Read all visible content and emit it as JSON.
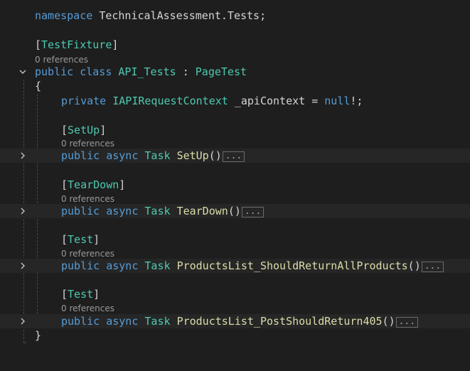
{
  "editor": {
    "namespace_line": {
      "keyword": "namespace",
      "name": "TechnicalAssessment.Tests",
      "semicolon": ";"
    },
    "class_attr": {
      "open": "[",
      "name": "TestFixture",
      "close": "]"
    },
    "class_refs": "0 references",
    "class_decl": {
      "kw1": "public",
      "kw2": "class",
      "name": "API_Tests",
      "colon": " : ",
      "base": "PageTest"
    },
    "open_brace": "{",
    "field": {
      "kw": "private",
      "type": "IAPIRequestContext",
      "name": " _apiContext ",
      "op": "= ",
      "value": "null",
      "rest": "!;"
    },
    "methods": [
      {
        "attr": "SetUp",
        "refs": "0 references",
        "kw1": "public",
        "kw2": "async",
        "ret": "Task",
        "name": "SetUp",
        "parens": "()",
        "collapsed": "..."
      },
      {
        "attr": "TearDown",
        "refs": "0 references",
        "kw1": "public",
        "kw2": "async",
        "ret": "Task",
        "name": "TearDown",
        "parens": "()",
        "collapsed": "..."
      },
      {
        "attr": "Test",
        "refs": "0 references",
        "kw1": "public",
        "kw2": "async",
        "ret": "Task",
        "name": "ProductsList_ShouldReturnAllProducts",
        "parens": "()",
        "collapsed": "..."
      },
      {
        "attr": "Test",
        "refs": "0 references",
        "kw1": "public",
        "kw2": "async",
        "ret": "Task",
        "name": "ProductsList_PostShouldReturn405",
        "parens": "()",
        "collapsed": "..."
      }
    ],
    "close_brace": "}",
    "bracket_open": "[",
    "bracket_close": "]",
    "colors": {
      "keyword": "#569cd6",
      "type": "#4ec9b0",
      "method": "#dcdcaa",
      "text": "#d4d4d4",
      "lens": "#999999",
      "background": "#1e1e1e"
    },
    "icons": {
      "expanded": "chevron-down-icon",
      "collapsed": "chevron-right-icon"
    }
  }
}
